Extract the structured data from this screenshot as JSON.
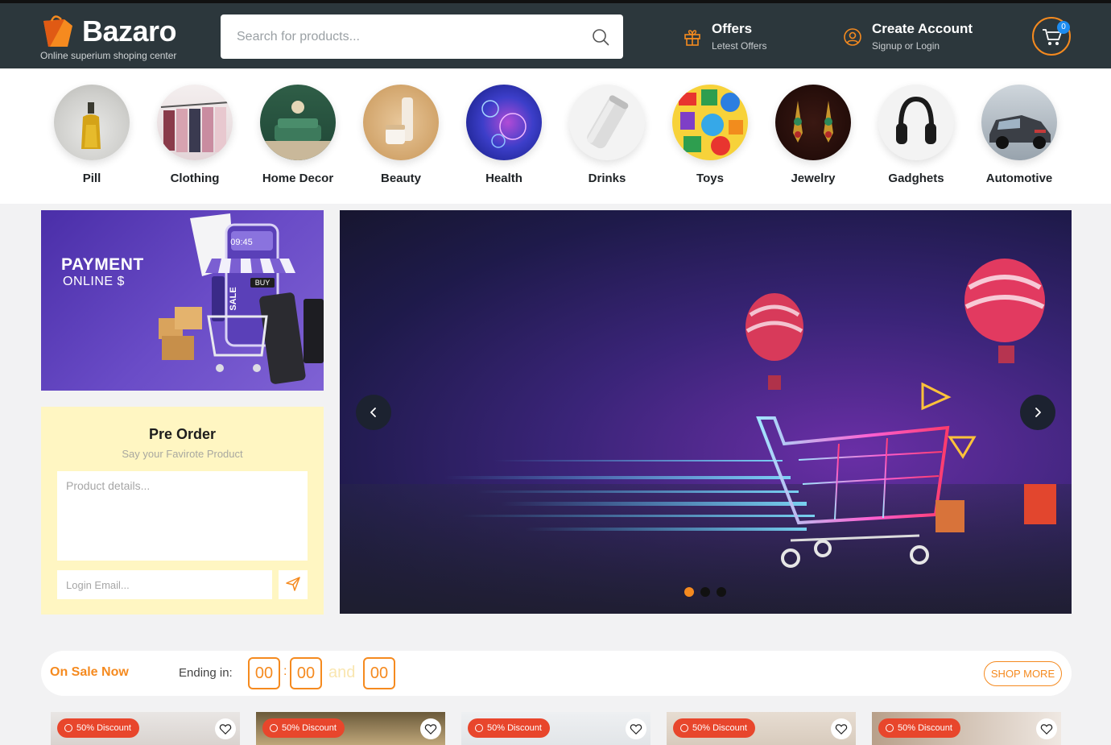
{
  "brand": {
    "name": "Bazaro",
    "tagline": "Online superium shoping center",
    "accent": "#f58a1f",
    "header_bg": "#2c373c"
  },
  "search": {
    "placeholder": "Search for products..."
  },
  "offers": {
    "title": "Offers",
    "subtitle": "Letest Offers"
  },
  "account": {
    "title": "Create Account",
    "subtitle": "Signup or Login"
  },
  "cart": {
    "count": "0"
  },
  "categories": [
    "Pill",
    "Clothing",
    "Home Decor",
    "Beauty",
    "Health",
    "Drinks",
    "Toys",
    "Jewelry",
    "Gadghets",
    "Automotive"
  ],
  "promo": {
    "title": "PAYMENT",
    "subtitle": "ONLINE $",
    "time": "09:45",
    "tag_buy": "BUY",
    "tag_sale": "SALE"
  },
  "preorder": {
    "title": "Pre Order",
    "subtitle": "Say your Favirote Product",
    "details_placeholder": "Product details...",
    "email_placeholder": "Login Email..."
  },
  "hero": {
    "active_slide": 1,
    "slide_count": 3
  },
  "sale": {
    "title": "On Sale Now",
    "ending_label": "Ending in:",
    "hours": "00",
    "minutes": "00",
    "and_label": "and",
    "seconds": "00",
    "shop_more": "SHOP MORE"
  },
  "products": [
    {
      "discount": "50% Discount"
    },
    {
      "discount": "50% Discount"
    },
    {
      "discount": "50% Discount"
    },
    {
      "discount": "50% Discount"
    },
    {
      "discount": "50% Discount"
    }
  ]
}
